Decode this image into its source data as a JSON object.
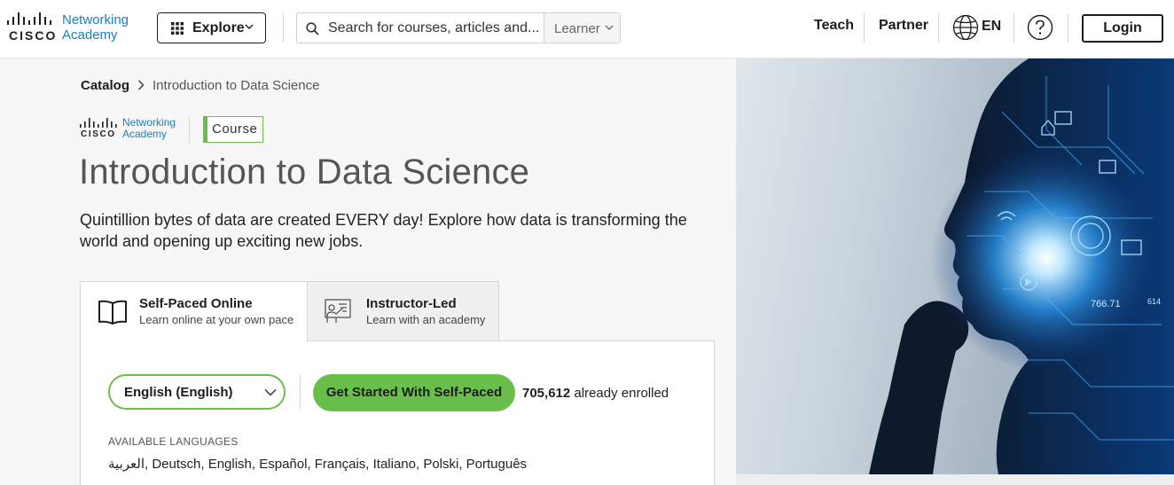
{
  "header": {
    "logo_brand": "CISCO",
    "logo_line1": "Networking",
    "logo_line2": "Academy",
    "explore_label": "Explore",
    "search_placeholder": "Search for courses, articles and...",
    "role_label": "Learner",
    "nav": [
      "Teach",
      "Partner"
    ],
    "language": "EN",
    "login_label": "Login"
  },
  "breadcrumb": {
    "catalog": "Catalog",
    "current": "Introduction to Data Science"
  },
  "course": {
    "brand_line1": "Networking",
    "brand_line2": "Academy",
    "brand_name": "CISCO",
    "badge": "Course",
    "title": "Introduction to Data Science",
    "description": "Quintillion bytes of data are created EVERY day! Explore how data is transforming the world and opening up exciting new jobs."
  },
  "tabs": [
    {
      "title": "Self-Paced Online",
      "subtitle": "Learn online at your own pace",
      "icon": "book-icon",
      "active": true
    },
    {
      "title": "Instructor-Led",
      "subtitle": "Learn with an academy",
      "icon": "instructor-icon",
      "active": false
    }
  ],
  "panel": {
    "language_selected": "English (English)",
    "start_button": "Get Started With Self-Paced",
    "enrolled_count": "705,612",
    "enrolled_suffix": "already enrolled",
    "available_heading": "AVAILABLE LANGUAGES",
    "available_list": "العربية, Deutsch, English, Español, Français, Italiano, Polski, Português"
  },
  "hero": {
    "numbers": [
      "766.71",
      "614"
    ]
  },
  "colors": {
    "accent_green": "#6abf4b",
    "cisco_blue": "#1a7fb8"
  }
}
